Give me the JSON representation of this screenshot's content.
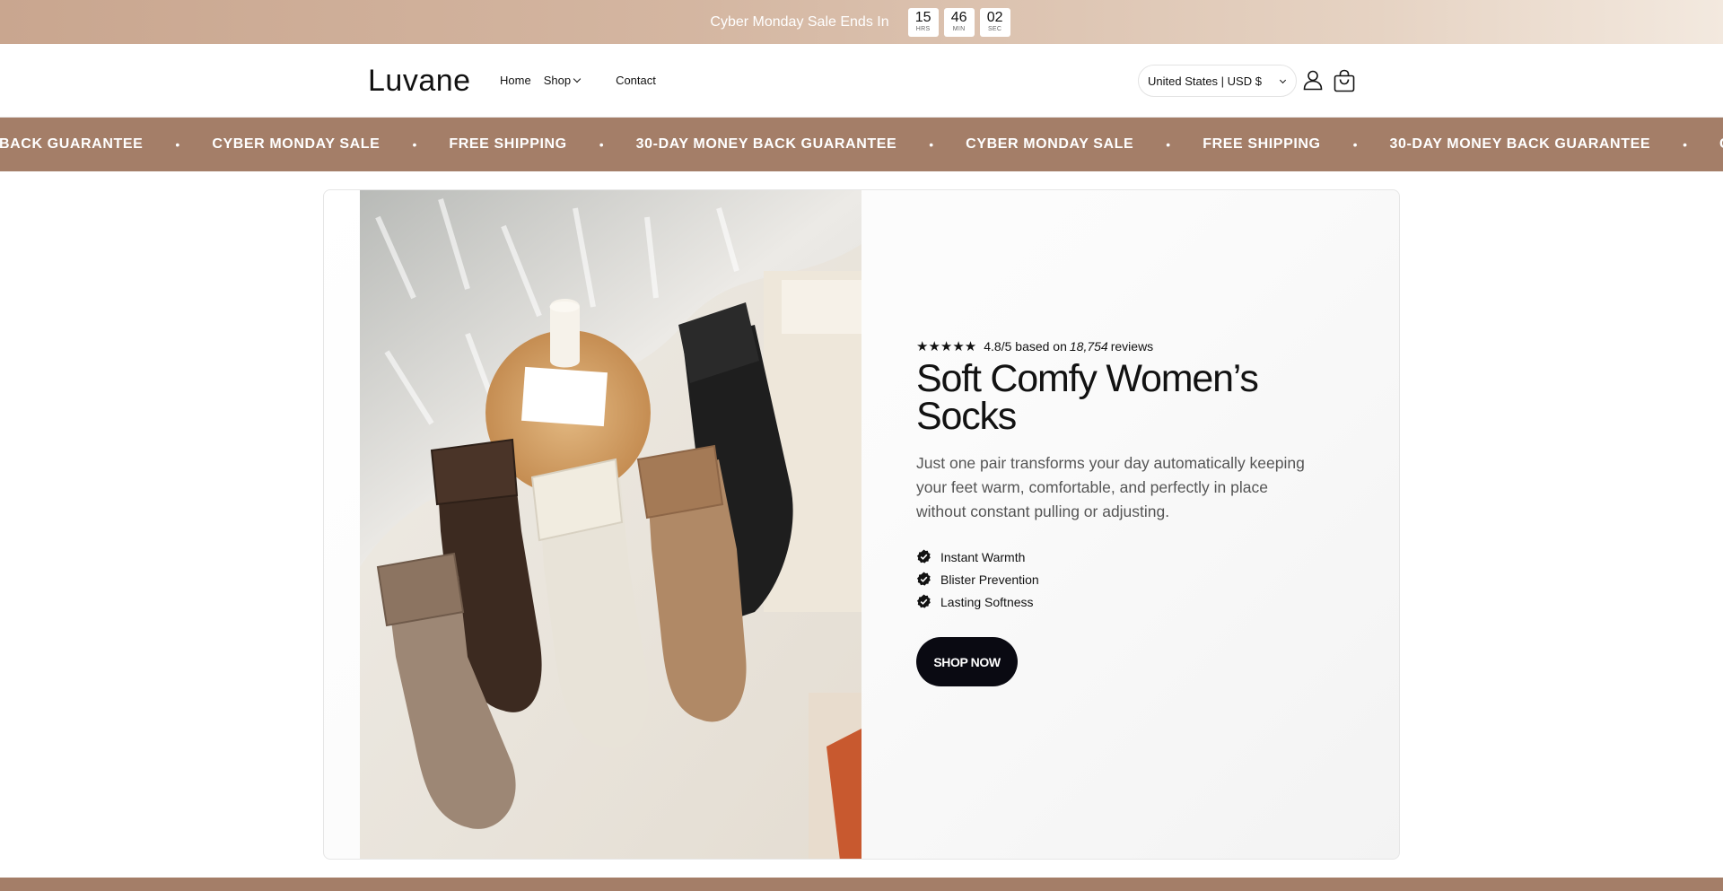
{
  "announcement": {
    "text": "Cyber Monday Sale Ends In",
    "timer": [
      {
        "value": "15",
        "unit": "HRS"
      },
      {
        "value": "46",
        "unit": "MIN"
      },
      {
        "value": "02",
        "unit": "SEC"
      }
    ]
  },
  "header": {
    "logo": "Luvane",
    "nav": {
      "home": "Home",
      "shop": "Shop",
      "contact": "Contact"
    },
    "country": "United States | USD $",
    "account_icon": "account-icon",
    "cart_icon": "cart-icon"
  },
  "marquee": {
    "items": [
      "BACK GUARANTEE",
      "CYBER MONDAY SALE",
      "FREE SHIPPING",
      "30-DAY MONEY BACK GUARANTEE",
      "CYBER MONDAY SALE",
      "FREE SHIPPING",
      "30-DAY MONEY BACK GUARANTEE",
      "CYBER MONDAY SALE"
    ],
    "separator": "•"
  },
  "hero": {
    "stars": "★★★★★",
    "rating_prefix": "4.8/5 based on",
    "rating_count": "18,754",
    "rating_suffix": "reviews",
    "title": "Soft Comfy Women’s Socks",
    "subtitle": "Just one pair transforms your day automatically keeping your feet warm, comfortable, and perfectly in place without constant pulling or adjusting.",
    "features": [
      "Instant Warmth",
      "Blister Prevention",
      "Lasting Softness"
    ],
    "cta": "SHOP NOW"
  },
  "colors": {
    "brand_brown": "#a47e68",
    "cta_black": "#0a0a12"
  }
}
